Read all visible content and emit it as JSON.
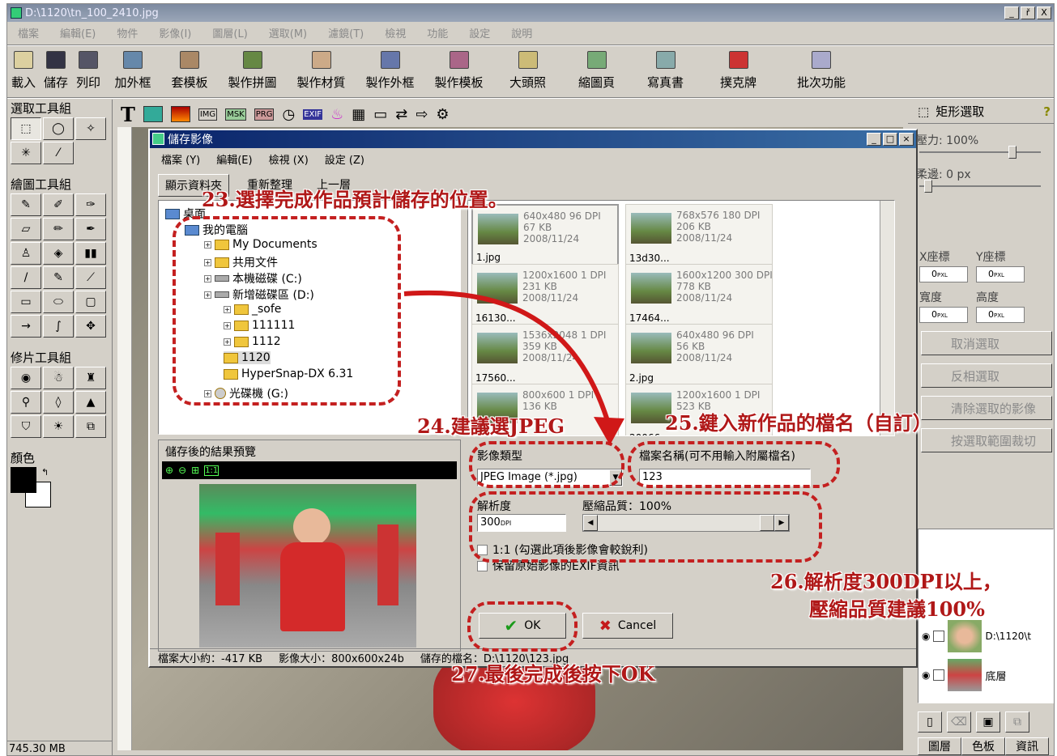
{
  "window": {
    "title": "D:\\1120\\tn_100_2410.jpg",
    "min": "_",
    "restore": "ř",
    "close": "X"
  },
  "menu": [
    "檔案",
    "編輯(E)",
    "物件",
    "影像(I)",
    "圖層(L)",
    "選取(M)",
    "濾鏡(T)",
    "檢視",
    "功能",
    "設定",
    "說明"
  ],
  "toolbar": [
    "載入",
    "儲存",
    "列印",
    "加外框",
    "套模板",
    "製作拼圖",
    "製作材質",
    "製作外框",
    "製作模板",
    "大頭照",
    "縮圖頁",
    "寫真書",
    "撲克牌",
    "批次功能"
  ],
  "left": {
    "select_group": "選取工具組",
    "draw_group": "繪圖工具組",
    "retouch_group": "修片工具組",
    "color_label": "顏色",
    "memory": "745.30 MB"
  },
  "dialog": {
    "title": "儲存影像",
    "menu": [
      "檔案 (Y)",
      "編輯(E)",
      "檢視 (X)",
      "設定 (Z)"
    ],
    "tabs": [
      "顯示資料夾",
      "重新整理",
      "上一層"
    ],
    "tree": [
      "桌面",
      "我的電腦",
      "My Documents",
      "共用文件",
      "本機磁碟 (C:)",
      "新增磁碟區 (D:)",
      "_sofe",
      "111111",
      "1112",
      "1120",
      "HyperSnap-DX 6.31",
      "光碟機 (G:)"
    ],
    "files": [
      {
        "meta": "640x480 96 DPI\n67 KB\n2008/11/24",
        "name": "1.jpg"
      },
      {
        "meta": "768x576 180 DPI\n206 KB\n2008/11/24",
        "name": "13d30..."
      },
      {
        "meta": "1200x1600 1 DPI\n231 KB\n2008/11/24",
        "name": "16130..."
      },
      {
        "meta": "1600x1200 300 DPI\n778 KB\n2008/11/24",
        "name": "17464..."
      },
      {
        "meta": "1536x2048 1 DPI\n359 KB\n2008/11/24",
        "name": "17560..."
      },
      {
        "meta": "640x480 96 DPI\n56 KB\n2008/11/24",
        "name": "2.jpg"
      },
      {
        "meta": "800x600 1 DPI\n136 KB",
        "name": ""
      },
      {
        "meta": "1200x1600 1 DPI\n523 KB",
        "name": "20066..."
      }
    ],
    "preview_label": "儲存後的結果預覽",
    "type_label": "影像類型",
    "type_value": "JPEG Image (*.jpg)",
    "filename_label": "檔案名稱(可不用輸入附屬檔名)",
    "filename_value": "123",
    "resolution_label": "解析度",
    "resolution_value": "300",
    "resolution_unit": "DPI",
    "quality_label": "壓縮品質：100%",
    "quality": 1.0,
    "opt1": "1:1 (勾選此項後影像會較銳利)",
    "opt2": "保留原始影像的EXIF資訊",
    "ok": "OK",
    "cancel": "Cancel",
    "status": [
      "檔案大小約：-417 KB",
      "影像大小：800x600x24b",
      "儲存的檔名：D:\\1120\\123.jpg"
    ]
  },
  "right": {
    "tool": "矩形選取",
    "pressure": "壓力: 100%",
    "feather": "柔邊: 0 px",
    "x": "X座標",
    "y": "Y座標",
    "w": "寬度",
    "h": "高度",
    "px": "0",
    "unit": "PXL",
    "b1": "取消選取",
    "b2": "反相選取",
    "b3": "清除選取的影像",
    "b4": "按選取範圍裁切",
    "layer1": "D:\\1120\\t",
    "layer2": "底層",
    "tabs": [
      "圖層",
      "色板",
      "資訊"
    ]
  },
  "annotations": [
    "23.選擇完成作品預計儲存的位置。",
    "24.建議選JPEG",
    "25.鍵入新作品的檔名（自訂）",
    "26.解析度300DPI以上，",
    "壓縮品質建議100%",
    "27.最後完成後按下OK"
  ],
  "colors": {
    "annotation": "#b01818",
    "dash": "#c42020",
    "title_active": "#0a246a"
  }
}
